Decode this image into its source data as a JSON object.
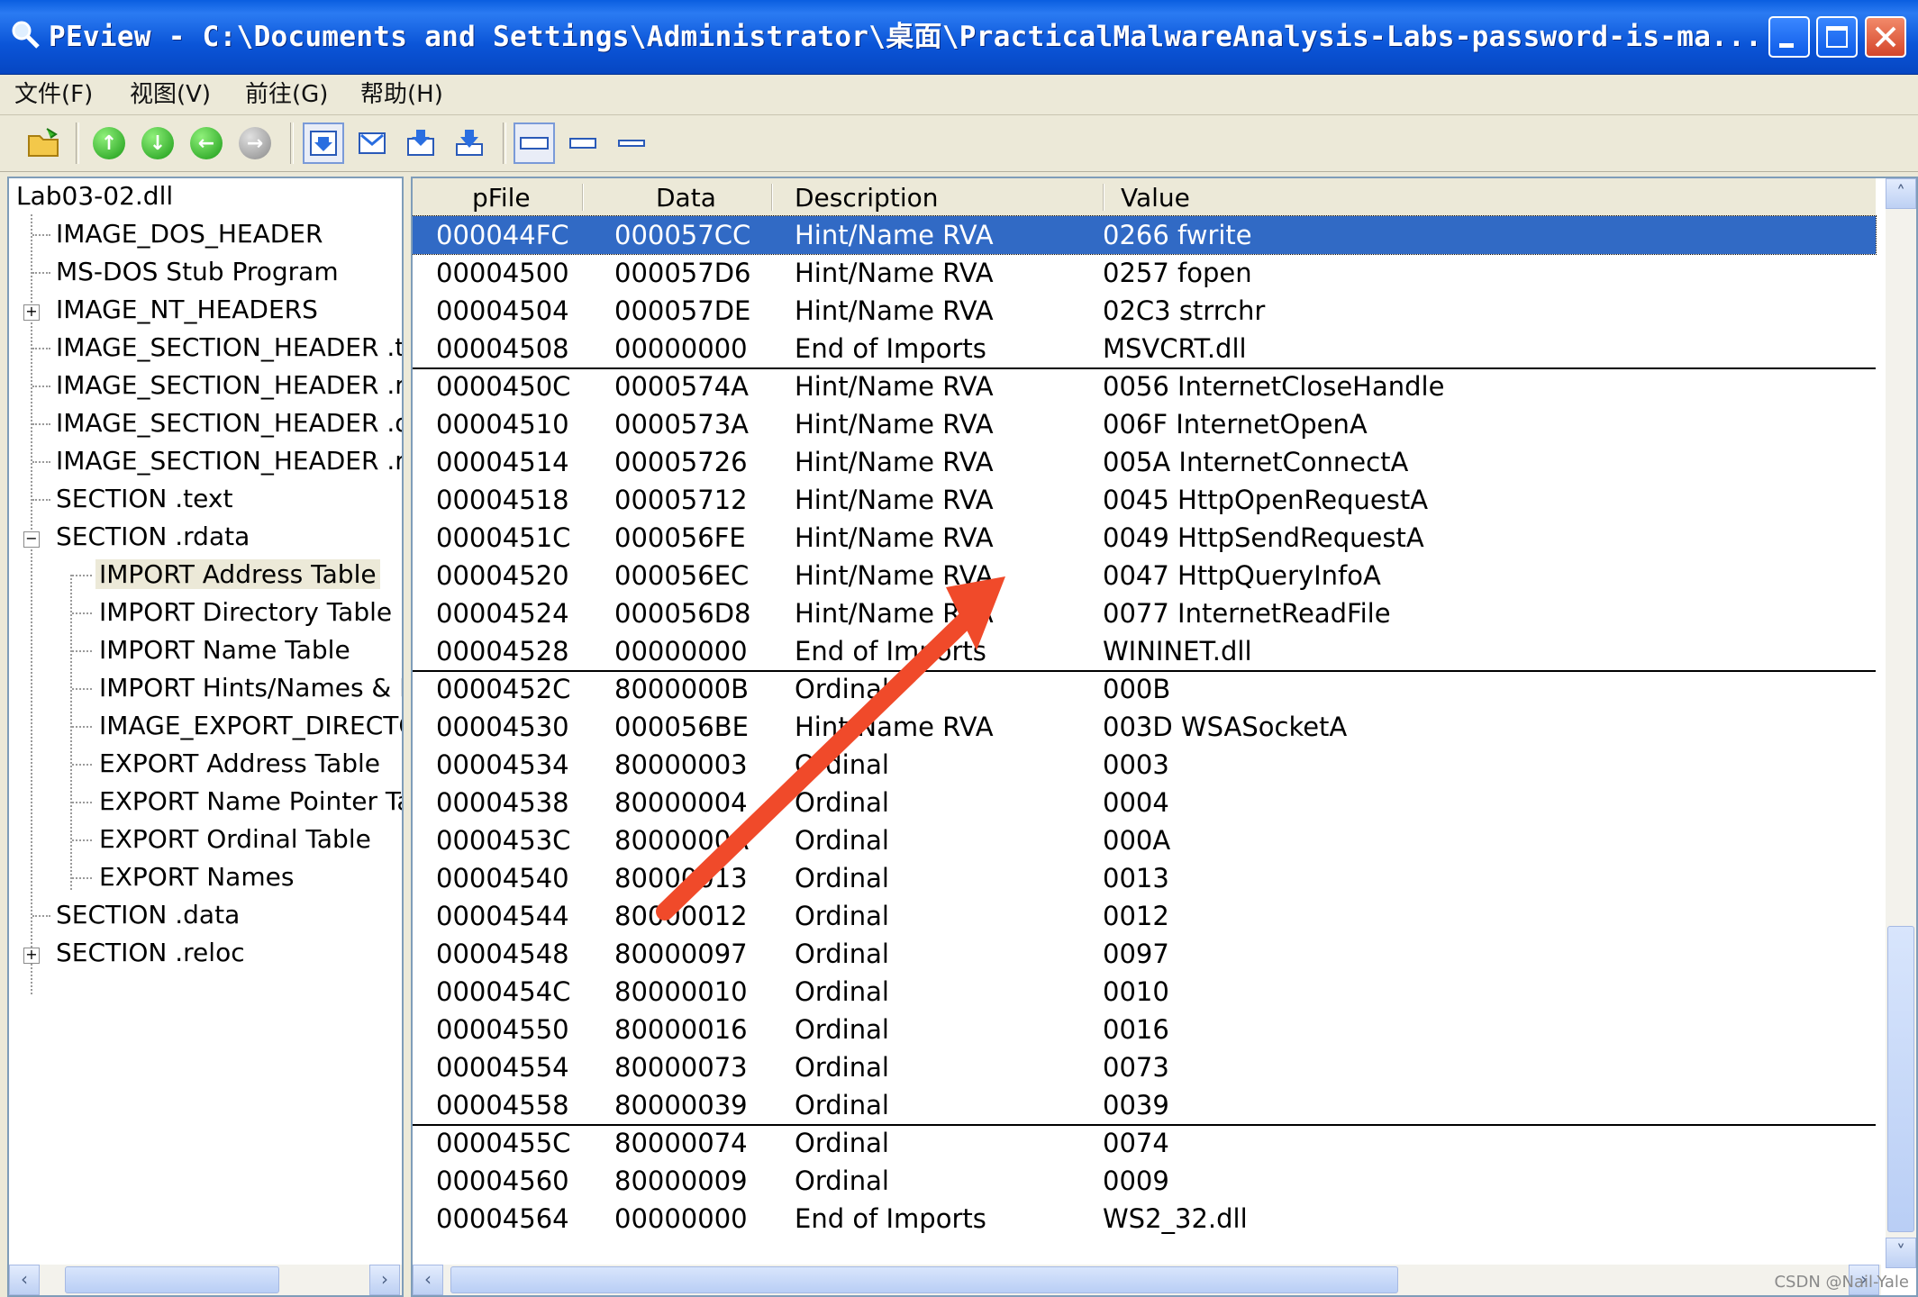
{
  "window": {
    "title": "PEview - C:\\Documents and Settings\\Administrator\\桌面\\PracticalMalwareAnalysis-Labs-password-is-ma...",
    "icon": "magnifier-icon"
  },
  "menu": {
    "items": [
      "文件(F)",
      "视图(V)",
      "前往(G)",
      "帮助(H)"
    ]
  },
  "toolbar": {
    "buttons": [
      "open-folder-icon",
      "up-arrow-icon",
      "down-arrow-icon",
      "back-arrow-icon",
      "forward-arrow-icon",
      "view-details-icon",
      "view-hex-icon",
      "view-import-icon",
      "view-export-icon",
      "mode-wide-icon",
      "mode-medium-icon",
      "mode-narrow-icon"
    ]
  },
  "tree": {
    "root": "Lab03-02.dll",
    "items": [
      {
        "label": "IMAGE_DOS_HEADER"
      },
      {
        "label": "MS-DOS Stub Program"
      },
      {
        "label": "IMAGE_NT_HEADERS"
      },
      {
        "label": "IMAGE_SECTION_HEADER .text"
      },
      {
        "label": "IMAGE_SECTION_HEADER .rdata"
      },
      {
        "label": "IMAGE_SECTION_HEADER .data"
      },
      {
        "label": "IMAGE_SECTION_HEADER .reloc"
      },
      {
        "label": "SECTION .text"
      },
      {
        "label": "SECTION .rdata"
      },
      {
        "label": "IMPORT Address Table"
      },
      {
        "label": "IMPORT Directory Table"
      },
      {
        "label": "IMPORT Name Table"
      },
      {
        "label": "IMPORT Hints/Names & DLL Names"
      },
      {
        "label": "IMAGE_EXPORT_DIRECTORY"
      },
      {
        "label": "EXPORT Address Table"
      },
      {
        "label": "EXPORT Name Pointer Table"
      },
      {
        "label": "EXPORT Ordinal Table"
      },
      {
        "label": "EXPORT Names"
      },
      {
        "label": "SECTION .data"
      },
      {
        "label": "SECTION .reloc"
      }
    ]
  },
  "list": {
    "columns": [
      "pFile",
      "Data",
      "Description",
      "Value"
    ],
    "rows": [
      {
        "pfile": "000044FC",
        "data": "000057CC",
        "desc": "Hint/Name RVA",
        "val": "0266  fwrite",
        "selected": true
      },
      {
        "pfile": "00004500",
        "data": "000057D6",
        "desc": "Hint/Name RVA",
        "val": "0257  fopen"
      },
      {
        "pfile": "00004504",
        "data": "000057DE",
        "desc": "Hint/Name RVA",
        "val": "02C3  strrchr"
      },
      {
        "pfile": "00004508",
        "data": "00000000",
        "desc": "End of Imports",
        "val": "MSVCRT.dll"
      },
      {
        "pfile": "0000450C",
        "data": "0000574A",
        "desc": "Hint/Name RVA",
        "val": "0056  InternetCloseHandle"
      },
      {
        "pfile": "00004510",
        "data": "0000573A",
        "desc": "Hint/Name RVA",
        "val": "006F  InternetOpenA"
      },
      {
        "pfile": "00004514",
        "data": "00005726",
        "desc": "Hint/Name RVA",
        "val": "005A  InternetConnectA"
      },
      {
        "pfile": "00004518",
        "data": "00005712",
        "desc": "Hint/Name RVA",
        "val": "0045  HttpOpenRequestA"
      },
      {
        "pfile": "0000451C",
        "data": "000056FE",
        "desc": "Hint/Name RVA",
        "val": "0049  HttpSendRequestA"
      },
      {
        "pfile": "00004520",
        "data": "000056EC",
        "desc": "Hint/Name RVA",
        "val": "0047  HttpQueryInfoA"
      },
      {
        "pfile": "00004524",
        "data": "000056D8",
        "desc": "Hint/Name RVA",
        "val": "0077  InternetReadFile"
      },
      {
        "pfile": "00004528",
        "data": "00000000",
        "desc": "End of Imports",
        "val": "WININET.dll"
      },
      {
        "pfile": "0000452C",
        "data": "8000000B",
        "desc": "Ordinal",
        "val": "000B"
      },
      {
        "pfile": "00004530",
        "data": "000056BE",
        "desc": "Hint/Name RVA",
        "val": "003D  WSASocketA"
      },
      {
        "pfile": "00004534",
        "data": "80000003",
        "desc": "Ordinal",
        "val": "0003"
      },
      {
        "pfile": "00004538",
        "data": "80000004",
        "desc": "Ordinal",
        "val": "0004"
      },
      {
        "pfile": "0000453C",
        "data": "8000000A",
        "desc": "Ordinal",
        "val": "000A"
      },
      {
        "pfile": "00004540",
        "data": "80000013",
        "desc": "Ordinal",
        "val": "0013"
      },
      {
        "pfile": "00004544",
        "data": "80000012",
        "desc": "Ordinal",
        "val": "0012"
      },
      {
        "pfile": "00004548",
        "data": "80000097",
        "desc": "Ordinal",
        "val": "0097"
      },
      {
        "pfile": "0000454C",
        "data": "80000010",
        "desc": "Ordinal",
        "val": "0010"
      },
      {
        "pfile": "00004550",
        "data": "80000016",
        "desc": "Ordinal",
        "val": "0016"
      },
      {
        "pfile": "00004554",
        "data": "80000073",
        "desc": "Ordinal",
        "val": "0073"
      },
      {
        "pfile": "00004558",
        "data": "80000039",
        "desc": "Ordinal",
        "val": "0039"
      },
      {
        "pfile": "0000455C",
        "data": "80000074",
        "desc": "Ordinal",
        "val": "0074"
      },
      {
        "pfile": "00004560",
        "data": "80000009",
        "desc": "Ordinal",
        "val": "0009"
      },
      {
        "pfile": "00004564",
        "data": "00000000",
        "desc": "End of Imports",
        "val": "WS2_32.dll"
      }
    ]
  },
  "annotation": {
    "arrow_color": "#f04a2a"
  },
  "watermark": "CSDN @Nail-Yale",
  "colors": {
    "selection": "#316ac5",
    "titlebar": "#0a5ee0"
  }
}
